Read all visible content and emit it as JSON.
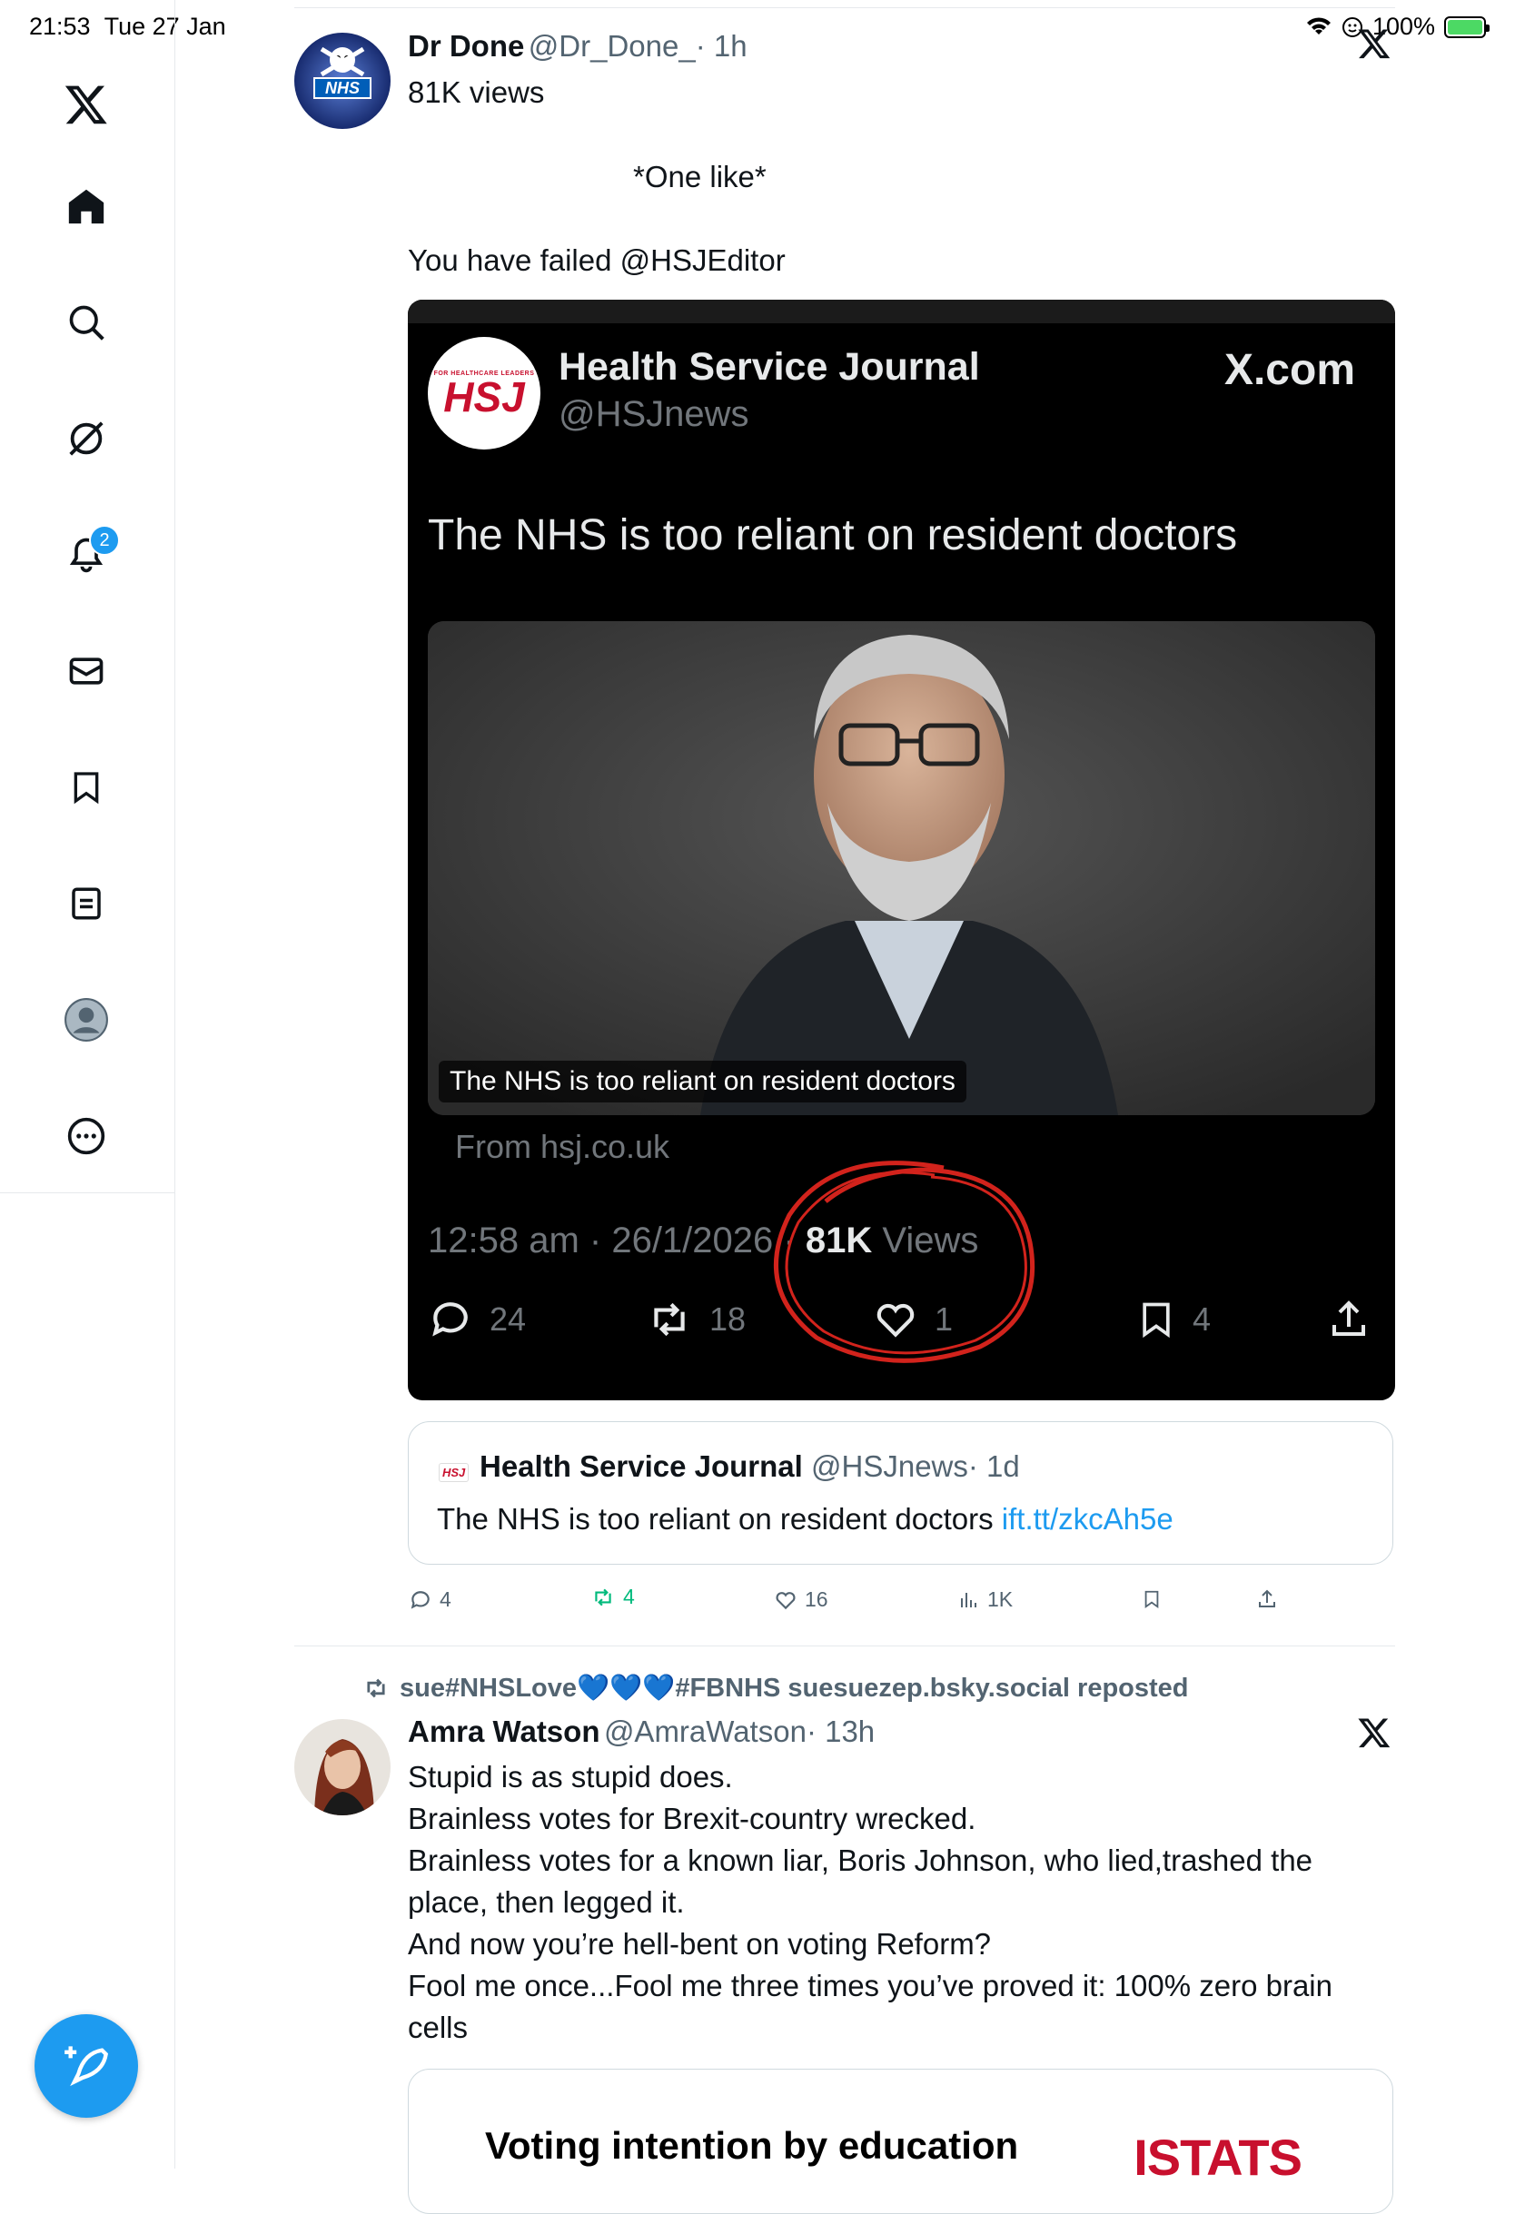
{
  "status_bar": {
    "time": "21:53",
    "date": "Tue 27 Jan",
    "battery": "100%"
  },
  "sidebar": {
    "items": [
      {
        "name": "home-icon"
      },
      {
        "name": "search-icon"
      },
      {
        "name": "grok-icon"
      },
      {
        "name": "notifications-icon",
        "badge": "2"
      },
      {
        "name": "messages-icon"
      },
      {
        "name": "bookmarks-icon"
      },
      {
        "name": "lists-icon"
      },
      {
        "name": "profile-icon"
      },
      {
        "name": "more-icon"
      }
    ],
    "compose": "compose-icon"
  },
  "post1": {
    "author_name": "Dr Done",
    "author_handle": "@Dr_Done_",
    "time": "· 1h",
    "views": "81K views",
    "avatar_text": "NHS",
    "line1": "*One like*",
    "line2": "You have failed @HSJEditor",
    "screenshot": {
      "account_name": "Health Service Journal",
      "account_handle": "@HSJnews",
      "logo_text": "HSJ",
      "logo_subtext": "FOR HEALTHCARE LEADERS",
      "site": "X.com",
      "headline": "The NHS is too reliant on resident doctors",
      "image_caption": "The NHS is too reliant on resident doctors",
      "from": "From hsj.co.uk",
      "timestamp": "12:58 am · 26/1/2026 ·",
      "views_count": "81K",
      "views_label": "Views",
      "replies": "24",
      "reposts": "18",
      "likes": "1",
      "bookmarks": "4"
    },
    "quote": {
      "logo_text": "HSJ",
      "name": "Health Service Journal",
      "handle": "@HSJnews",
      "time": "· 1d",
      "text": "The NHS is too reliant on resident doctors ",
      "link": "ift.tt/zkcAh5e"
    },
    "actions": {
      "replies": "4",
      "reposts": "4",
      "likes": "16",
      "views": "1K"
    }
  },
  "post2": {
    "repost_by": "sue#NHSLove💙💙💙#FBNHS suesuezep.bsky.social reposted",
    "author_name": "Amra Watson",
    "author_handle": "@AmraWatson",
    "time": "· 13h",
    "lines": [
      "Stupid is as stupid does.",
      "Brainless votes for Brexit-country wrecked.",
      "Brainless votes for a known liar, Boris Johnson, who lied,trashed the place, then legged it.",
      "And now you’re hell-bent on voting Reform?",
      "Fool me once...Fool me three times you’ve proved it: 100% zero brain cells"
    ],
    "card_title": "Voting intention by education",
    "card_logo": "ISTATS"
  }
}
